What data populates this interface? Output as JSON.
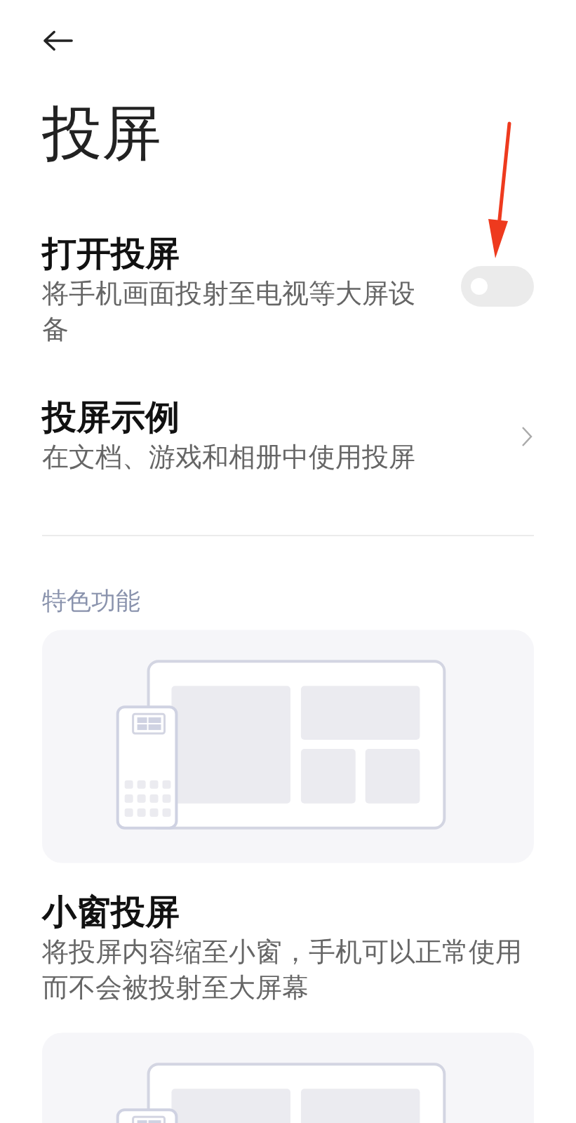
{
  "title": "投屏",
  "settings": [
    {
      "kind": "toggle",
      "title": "打开投屏",
      "description": "将手机画面投射至电视等大屏设备",
      "on": false
    },
    {
      "kind": "link",
      "title": "投屏示例",
      "description": "在文档、游戏和相册中使用投屏"
    }
  ],
  "features": {
    "section_title": "特色功能",
    "items": [
      {
        "kind": "illustration"
      },
      {
        "kind": "text",
        "title": "小窗投屏",
        "description": "将投屏内容缩至小窗，手机可以正常使用而不会被投射至大屏幕"
      },
      {
        "kind": "illustration"
      }
    ]
  }
}
